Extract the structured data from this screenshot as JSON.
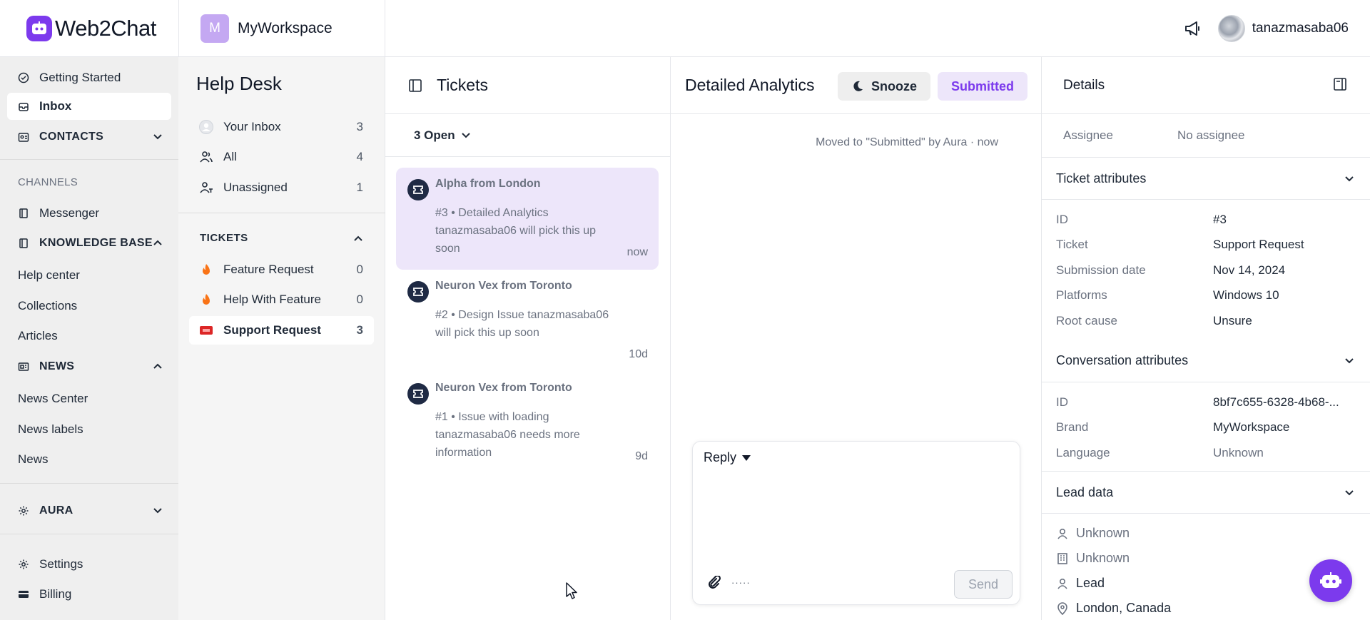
{
  "app": {
    "logo_text": "Web2Chat",
    "workspace_initial": "M",
    "workspace_name": "MyWorkspace",
    "user_name": "tanazmasaba06"
  },
  "nav": {
    "getting_started": "Getting Started",
    "inbox": "Inbox",
    "contacts": "CONTACTS",
    "channels_label": "CHANNELS",
    "messenger": "Messenger",
    "knowledge_base": "KNOWLEDGE BASE",
    "help_center": "Help center",
    "collections": "Collections",
    "articles": "Articles",
    "news": "NEWS",
    "news_center": "News Center",
    "news_labels": "News labels",
    "news_item": "News",
    "aura": "AURA",
    "settings": "Settings",
    "billing": "Billing"
  },
  "helpdesk": {
    "title": "Help Desk",
    "views": [
      {
        "label": "Your Inbox",
        "count": "3"
      },
      {
        "label": "All",
        "count": "4"
      },
      {
        "label": "Unassigned",
        "count": "1"
      }
    ],
    "tickets_section": "TICKETS",
    "ticket_types": [
      {
        "label": "Feature Request",
        "count": "0"
      },
      {
        "label": "Help With Feature",
        "count": "0"
      },
      {
        "label": "Support Request",
        "count": "3"
      }
    ]
  },
  "tickets": {
    "title": "Tickets",
    "filter": "3 Open",
    "items": [
      {
        "from": "Alpha from London",
        "body": "#3 • Detailed Analytics tanazmasaba06 will pick this up soon",
        "time": "now"
      },
      {
        "from": "Neuron Vex from Toronto",
        "body": "#2 • Design Issue tanazmasaba06 will pick this up soon",
        "time": "10d"
      },
      {
        "from": "Neuron Vex from Toronto",
        "body": "#1 • Issue with loading tanazmasaba06 needs more information",
        "time": "9d"
      }
    ]
  },
  "conversation": {
    "title": "Detailed Analytics",
    "snooze_label": "Snooze",
    "status_label": "Submitted",
    "event": "Moved to \"Submitted\" by Aura · now",
    "reply_mode": "Reply",
    "tools_more": "·····",
    "send_label": "Send"
  },
  "details": {
    "title": "Details",
    "assignee_key": "Assignee",
    "assignee_value": "No assignee",
    "ticket_attributes_title": "Ticket attributes",
    "ticket_attributes": [
      {
        "k": "ID",
        "v": "#3"
      },
      {
        "k": "Ticket",
        "v": "Support Request"
      },
      {
        "k": "Submission date",
        "v": "Nov 14, 2024"
      },
      {
        "k": "Platforms",
        "v": "Windows 10"
      },
      {
        "k": "Root cause",
        "v": "Unsure"
      }
    ],
    "conversation_attributes_title": "Conversation attributes",
    "conversation_attributes": [
      {
        "k": "ID",
        "v": "8bf7c655-6328-4b68-..."
      },
      {
        "k": "Brand",
        "v": "MyWorkspace"
      },
      {
        "k": "Language",
        "v": "Unknown"
      }
    ],
    "lead_data_title": "Lead data",
    "lead_data": [
      "Unknown",
      "Unknown",
      "Lead",
      "London, Canada"
    ]
  },
  "colors": {
    "accent": "#7c3aed",
    "selected_bg": "#ede6fa",
    "nav_bg": "#efefef"
  }
}
